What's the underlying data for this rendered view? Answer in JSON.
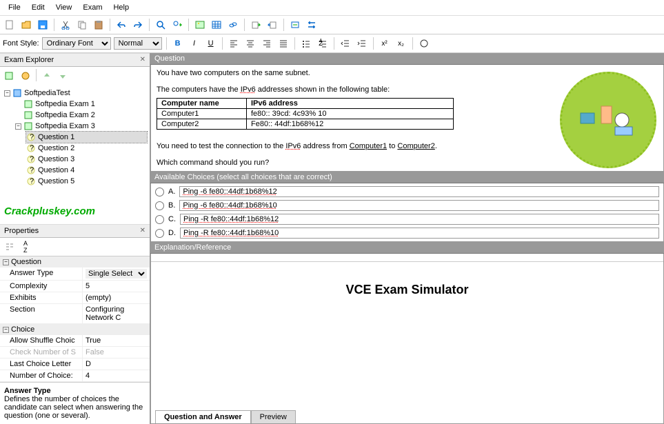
{
  "menu": {
    "file": "File",
    "edit": "Edit",
    "view": "View",
    "exam": "Exam",
    "help": "Help"
  },
  "font_row": {
    "label": "Font Style:",
    "style": "Ordinary Font",
    "size": "Normal"
  },
  "explorer": {
    "title": "Exam Explorer",
    "root": "SoftpediaTest",
    "exams": [
      "Softpedia Exam 1",
      "Softpedia Exam 2",
      "Softpedia Exam 3"
    ],
    "questions": [
      "Question 1",
      "Question 2",
      "Question 3",
      "Question 4",
      "Question 5"
    ]
  },
  "watermark": "Crackpluskey.com",
  "properties": {
    "title": "Properties",
    "cat1": "Question",
    "answer_type_label": "Answer Type",
    "answer_type_val": "Single Select",
    "complexity_label": "Complexity",
    "complexity_val": "5",
    "exhibits_label": "Exhibits",
    "exhibits_val": "(empty)",
    "section_label": "Section",
    "section_val": "Configuring Network C",
    "cat2": "Choice",
    "shuffle_label": "Allow Shuffle Choic",
    "shuffle_val": "True",
    "checknum_label": "Check Number of S",
    "checknum_val": "False",
    "lastletter_label": "Last Choice Letter",
    "lastletter_val": "D",
    "numchoice_label": "Number of Choice:",
    "numchoice_val": "4",
    "desc_title": "Answer Type",
    "desc_text": "Defines the number of choices the candidate can select when answering the question (one or several)."
  },
  "question": {
    "header": "Question",
    "line1": "You have two computers on the same subnet.",
    "line2_pre": "The computers have the ",
    "line2_ipv6": "IPv6",
    "line2_post": " addresses shown in the following table:",
    "table": {
      "col1": "Computer name",
      "col2": "IPv6 address",
      "r1c1": "Computer1",
      "r1c2": "fe80:: 39cd: 4c93% 10",
      "r2c1": "Computer2",
      "r2c2": "Fe80:: 44df:1b68%12"
    },
    "line3_pre": "You need to test the connection to the ",
    "line3_ipv6": "IPv6",
    "line3_mid": " address from ",
    "line3_c1": "Computer1",
    "line3_to": " to ",
    "line3_c2": "Computer2",
    "line3_end": ".",
    "line4": "Which command should you run?"
  },
  "choices": {
    "header": "Available Choices (select all choices that are correct)",
    "labels": [
      "A.",
      "B.",
      "C.",
      "D."
    ],
    "texts": [
      "Ping -6 fe80::44df:1b68%12",
      "Ping -6 fe80::44df:1b68%10",
      "Ping -R fe80::44df:1b68%12",
      "Ping -R fe80::44df:1b68%10"
    ]
  },
  "explanation": {
    "header": "Explanation/Reference",
    "vce": "VCE Exam Simulator"
  },
  "tabs": {
    "qa": "Question and Answer",
    "preview": "Preview"
  }
}
